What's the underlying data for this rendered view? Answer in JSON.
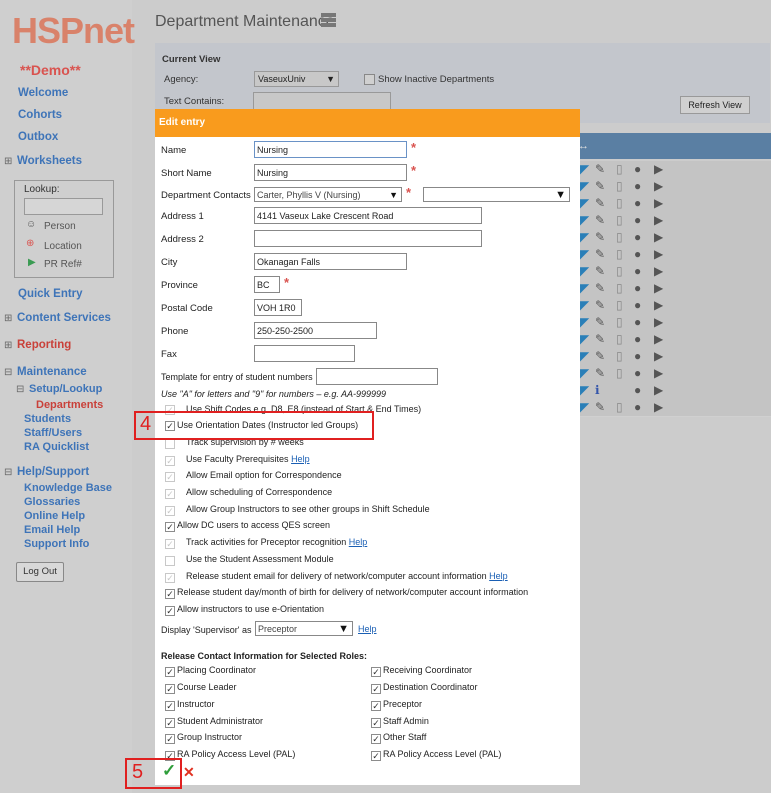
{
  "app": {
    "logo_main": "HSPnet",
    "demo_label": "**Demo**"
  },
  "sidebar": {
    "welcome": "Welcome",
    "cohorts": "Cohorts",
    "outbox": "Outbox",
    "worksheets": "Worksheets",
    "lookup_label": "Lookup:",
    "lookup_person": "Person",
    "lookup_location": "Location",
    "lookup_prref": "PR Ref#",
    "quick_entry": "Quick Entry",
    "content_services": "Content Services",
    "reporting": "Reporting",
    "maintenance": "Maintenance",
    "setup_lookup": "Setup/Lookup",
    "departments": "Departments",
    "students": "Students",
    "staff_users": "Staff/Users",
    "ra_quicklist": "RA Quicklist",
    "help_support": "Help/Support",
    "knowledge_base": "Knowledge Base",
    "glossaries": "Glossaries",
    "online_help": "Online Help",
    "email_help": "Email Help",
    "support_info": "Support Info",
    "logout": "Log Out"
  },
  "page": {
    "title": "Department Maintenance"
  },
  "current_view": {
    "heading": "Current View",
    "agency_label": "Agency:",
    "agency_value": "VaseuxUniv",
    "show_inactive": "Show Inactive Departments",
    "text_contains": "Text Contains:",
    "refresh": "Refresh View"
  },
  "modal": {
    "title": "Edit entry",
    "name_label": "Name",
    "name_value": "Nursing",
    "short_label": "Short Name",
    "short_value": "Nursing",
    "contacts_label": "Department Contacts",
    "contacts_value": "Carter, Phyllis V (Nursing)",
    "addr1_label": "Address 1",
    "addr1_value": "4141 Vaseux Lake Crescent Road",
    "addr2_label": "Address 2",
    "addr2_value": "",
    "city_label": "City",
    "city_value": "Okanagan Falls",
    "province_label": "Province",
    "province_value": "BC",
    "postal_label": "Postal Code",
    "postal_value": "VOH 1R0",
    "phone_label": "Phone",
    "phone_value": "250-250-2500",
    "fax_label": "Fax",
    "fax_value": "",
    "template_label": "Template for entry of student numbers",
    "template_hint": "Use \"A\" for letters and \"9\" for numbers – e.g. AA-999999",
    "opt_shift": "Use Shift Codes e.g. D8, E8 (instead of Start & End Times)",
    "opt_orientation": "Use Orientation Dates (Instructor led Groups)",
    "opt_track_weeks": "Track supervision by # weeks",
    "opt_faculty_prereq": "Use Faculty Prerequisites",
    "opt_email_corr": "Allow Email option for Correspondence",
    "opt_sched_corr": "Allow scheduling of Correspondence",
    "opt_group_instr": "Allow Group Instructors to see other groups in Shift Schedule",
    "opt_dc_qes": "Allow DC users to access QES screen",
    "opt_track_preceptor": "Track activities for Preceptor recognition",
    "opt_student_assess": "Use the Student Assessment Module",
    "opt_release_email": "Release student email for delivery of network/computer account information",
    "opt_release_dob": "Release student day/month of birth for delivery of network/computer account information",
    "opt_eorient": "Allow instructors to use e-Orientation",
    "help": "Help",
    "display_supervisor": "Display 'Supervisor' as",
    "supervisor_value": "Preceptor",
    "release_heading": "Release Contact Information for Selected Roles:",
    "roles_left": [
      "Placing Coordinator",
      "Course Leader",
      "Instructor",
      "Student Administrator",
      "Group Instructor",
      "RA Policy Access Level (PAL)"
    ],
    "roles_right": [
      "Receiving Coordinator",
      "Destination Coordinator",
      "Preceptor",
      "Staff Admin",
      "Other Staff",
      "RA Policy Access Level (PAL)"
    ]
  },
  "callouts": {
    "four": "4",
    "five": "5"
  },
  "icons": {
    "check": "✓",
    "cross": "✕"
  }
}
